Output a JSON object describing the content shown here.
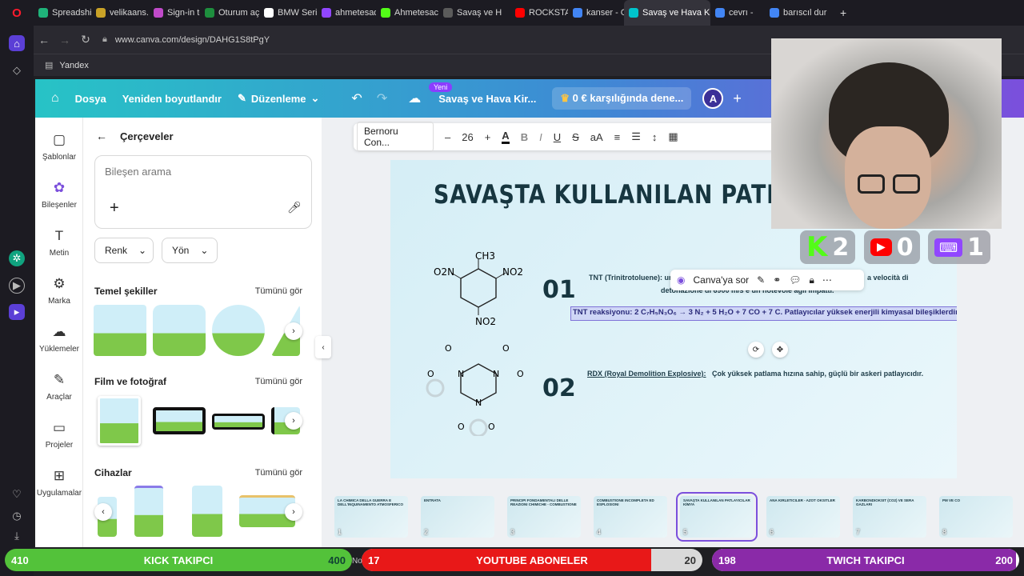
{
  "browser": {
    "tabs": [
      {
        "label": "Spreadshir",
        "color": "#1fb37a"
      },
      {
        "label": "velikaans.c",
        "color": "#c9a227"
      },
      {
        "label": "Sign-in to",
        "color": "#c04ac9"
      },
      {
        "label": "Oturum aç",
        "color": "#1e8e3e"
      },
      {
        "label": "BMW Serie",
        "color": "#ffffff"
      },
      {
        "label": "ahmetesad",
        "color": "#9146ff"
      },
      {
        "label": "Ahmetesac",
        "color": "#53fc18"
      },
      {
        "label": "Savaş ve H",
        "color": "#5b5b5b"
      },
      {
        "label": "ROCKSTAR",
        "color": "#ff0000"
      },
      {
        "label": "kanser - Go",
        "color": "#4285f4"
      },
      {
        "label": "Savaş ve Hava Kirli",
        "color": "#00c4cc"
      },
      {
        "label": "cevrı -",
        "color": "#4285f4"
      },
      {
        "label": "barıscıl dur",
        "color": "#4285f4"
      }
    ],
    "url": "www.canva.com/design/DAHG1S8tPgY",
    "bookmark": "Yandex"
  },
  "canva_header": {
    "file": "Dosya",
    "resize": "Yeniden boyutlandır",
    "edit": "Düzenleme",
    "new_badge": "Yeni",
    "doc_title": "Savaş ve Hava Kir...",
    "trial": "0 € karşılığında dene...",
    "avatar": "A"
  },
  "icon_column": [
    {
      "label": "Şablonlar",
      "icon": "templates-icon"
    },
    {
      "label": "Bileşenler",
      "icon": "elements-icon"
    },
    {
      "label": "Metin",
      "icon": "text-icon"
    },
    {
      "label": "Marka",
      "icon": "brand-icon"
    },
    {
      "label": "Yüklemeler",
      "icon": "upload-icon"
    },
    {
      "label": "Araçlar",
      "icon": "tools-icon"
    },
    {
      "label": "Projeler",
      "icon": "folder-icon"
    },
    {
      "label": "Uygulamalar",
      "icon": "apps-icon"
    }
  ],
  "panel": {
    "title": "Çerçeveler",
    "search_placeholder": "Bileşen arama",
    "filter_color": "Renk",
    "filter_direction": "Yön",
    "sections": [
      {
        "title": "Temel şekiller",
        "see_all": "Tümünü gör"
      },
      {
        "title": "Film ve fotoğraf",
        "see_all": "Tümünü gör"
      },
      {
        "title": "Cihazlar",
        "see_all": "Tümünü gör"
      }
    ]
  },
  "toolbar": {
    "font": "Bernoru Con...",
    "size": "26"
  },
  "slide": {
    "title": "SAVAŞTA KULLANILAN PATLAYICIL",
    "item1_num": "01",
    "item1_text": "TNT (Trinitrotoluene): un",
    "item1_text_tail": "a velocità di",
    "item1_line2": "detonazione di 6900 m/s e un notevole agli impatti.",
    "selected_text": "TNT reaksiyonu: 2 C₇H₅N₃O₆ → 3 N₂ + 5 H₂O + 7 CO + 7 C. Patlayıcılar yüksek enerjili kimyasal bileşiklerdir.",
    "item2_num": "02",
    "item2_label": "RDX (Royal Demolition Explosive):",
    "item2_text": "Çok yüksek patlama hızına sahip, güçlü bir askeri patlayıcıdır.",
    "mol1": {
      "ch3": "CH3",
      "no2_l": "O2N",
      "no2_r": "NO2",
      "no2_b": "NO2"
    },
    "ask_canva": "Canva'ya sor"
  },
  "filmstrip": [
    {
      "no": "1",
      "cap": "LA CHIMICA DELLA GUERRA E DELL'INQUINAMENTO ATMOSFERICO"
    },
    {
      "no": "2",
      "cap": "ENTRATA"
    },
    {
      "no": "3",
      "cap": "PRINCIPI FONDAMENTALI DELLE REAZIONI CHIMICHE - COMBUSTIONE"
    },
    {
      "no": "4",
      "cap": "COMBUSTIONE INCOMPLETA ED ESPLOSIONI"
    },
    {
      "no": "5",
      "cap": "SAVAŞTA KULLANILAN PATLAYICILAR KİMYA"
    },
    {
      "no": "6",
      "cap": "ANA KIRLETICILER - AZOT OKSITLER"
    },
    {
      "no": "7",
      "cap": "KARBONDIOKSIT (CO2) VE SERA GAZLARI"
    },
    {
      "no": "8",
      "cap": "PM VE CO"
    }
  ],
  "stream": {
    "kick_count": "2",
    "youtube_count": "0",
    "twitch_count": "1",
    "kick_bar": {
      "label": "KICK TAKIPCI",
      "current": "410",
      "goal": "400",
      "color": "#53c23a"
    },
    "youtube_bar": {
      "label": "YOUTUBE ABONELER",
      "current": "17",
      "goal": "20",
      "color": "#e81818",
      "progress": 0.85
    },
    "twitch_bar": {
      "label": "TWICH TAKIPCI",
      "current": "198",
      "goal": "200",
      "color": "#8a2aa8",
      "progress": 0.99
    }
  },
  "canvas_left_tabs_note": "",
  "page_hidden_partial": "No"
}
